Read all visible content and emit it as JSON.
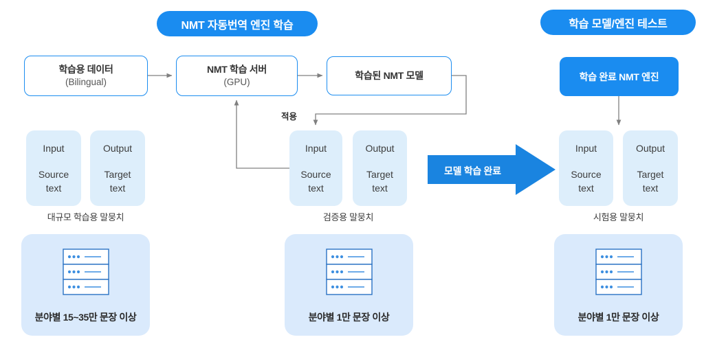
{
  "colors": {
    "accent_blue": "#1a8cf0",
    "light_blue_box": "#ddeefb",
    "card_blue": "#daeafc",
    "connector_gray": "#808080",
    "text_dark": "#333333"
  },
  "titles": {
    "left_pill": "NMT 자동번역 엔진 학습",
    "right_pill": "학습 모델/엔진 테스트"
  },
  "process": {
    "train_data_title": "학습용 데이터",
    "train_data_sub": "(Bilingual)",
    "train_server_title": "NMT 학습 서버",
    "train_server_sub": "(GPU)",
    "trained_model_title": "학습된 NMT 모델",
    "finished_engine_title": "학습 완료 NMT 엔진"
  },
  "connectors": {
    "apply_label": "적용",
    "transition_label": "모델 학습 완료"
  },
  "corpora": [
    {
      "name": "training",
      "input_head": "Input",
      "input_body": "Source\ntext",
      "output_head": "Output",
      "output_body": "Target\ntext",
      "caption": "대규모 학습용 말뭉치",
      "card_label": "분야별 15~35만 문장 이상"
    },
    {
      "name": "validation",
      "input_head": "Input",
      "input_body": "Source\ntext",
      "output_head": "Output",
      "output_body": "Target\ntext",
      "caption": "검증용 말뭉치",
      "card_label": "분야별 1만 문장 이상"
    },
    {
      "name": "test",
      "input_head": "Input",
      "input_body": "Source\ntext",
      "output_head": "Output",
      "output_body": "Target\ntext",
      "caption": "시험용 말뭉치",
      "card_label": "분야별 1만 문장 이상"
    }
  ],
  "icons": {
    "server_stack": "server-stack-icon",
    "arrow_right": "arrow-right-icon"
  }
}
